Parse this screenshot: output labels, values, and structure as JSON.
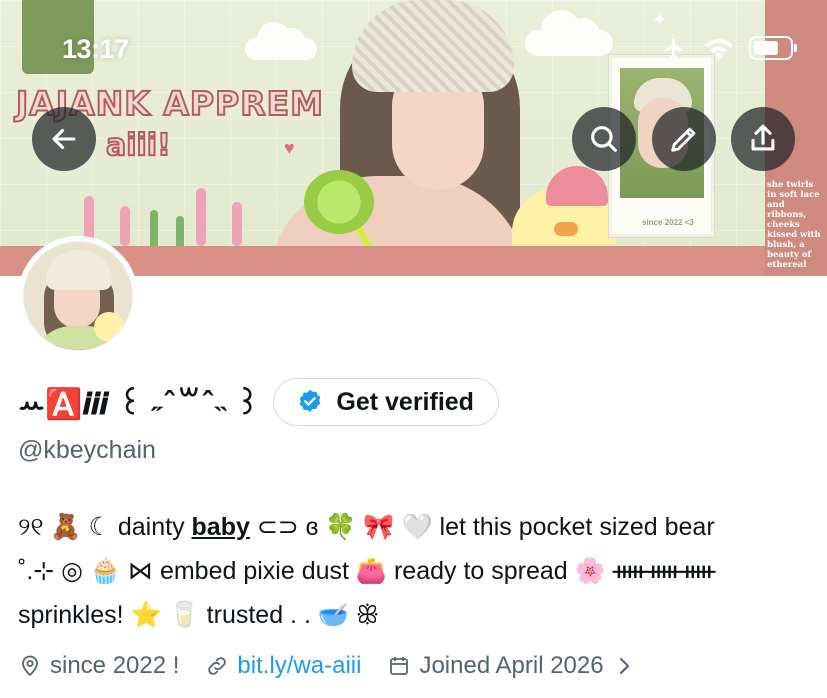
{
  "status_bar": {
    "time": "13:17",
    "icons": [
      "airplane-icon",
      "wifi-icon",
      "battery-icon"
    ],
    "battery_level": 0.7
  },
  "banner": {
    "title": "JAJANK APPREM",
    "subtitle": "aiii!",
    "polaroid_caption": "since 2022 <3",
    "side_text": "she twirls in soft lace and ribbons, cheeks kissed with blush, a beauty of ethereal"
  },
  "header_actions": {
    "back": "back-arrow-icon",
    "search": "search-icon",
    "edit": "pencil-icon",
    "share": "share-icon"
  },
  "profile": {
    "display_name": "ꕀ🅰️𝒊𝒊𝒊 ꒰ ˶ˆ꒳ˆ˵ ꒱",
    "verify_button_label": "Get verified",
    "handle": "@kbeychain",
    "bio_lines": [
      "୨୧ 🧸 ☾ dainty baby ⊂⊃ ɞ 🍀 🎀 🤍 let this pocket sized bear",
      "˚.⊹ ◎ 🧁 ⋈ embed pixie dust 👛 ready to spread 🌸 ᚔᚔᚔ",
      "sprinkles! ⭐ 🥛 trusted . . 🥣 ꕥ"
    ],
    "bio_underlined": "baby",
    "location": "since 2022 !",
    "link": "bit.ly/wa-aiii",
    "joined": "Joined April 2026"
  },
  "colors": {
    "accent": "#1d9bf0",
    "secondary_text": "#536471",
    "banner_pink": "#d88f86",
    "banner_green": "#e5ecd3"
  }
}
